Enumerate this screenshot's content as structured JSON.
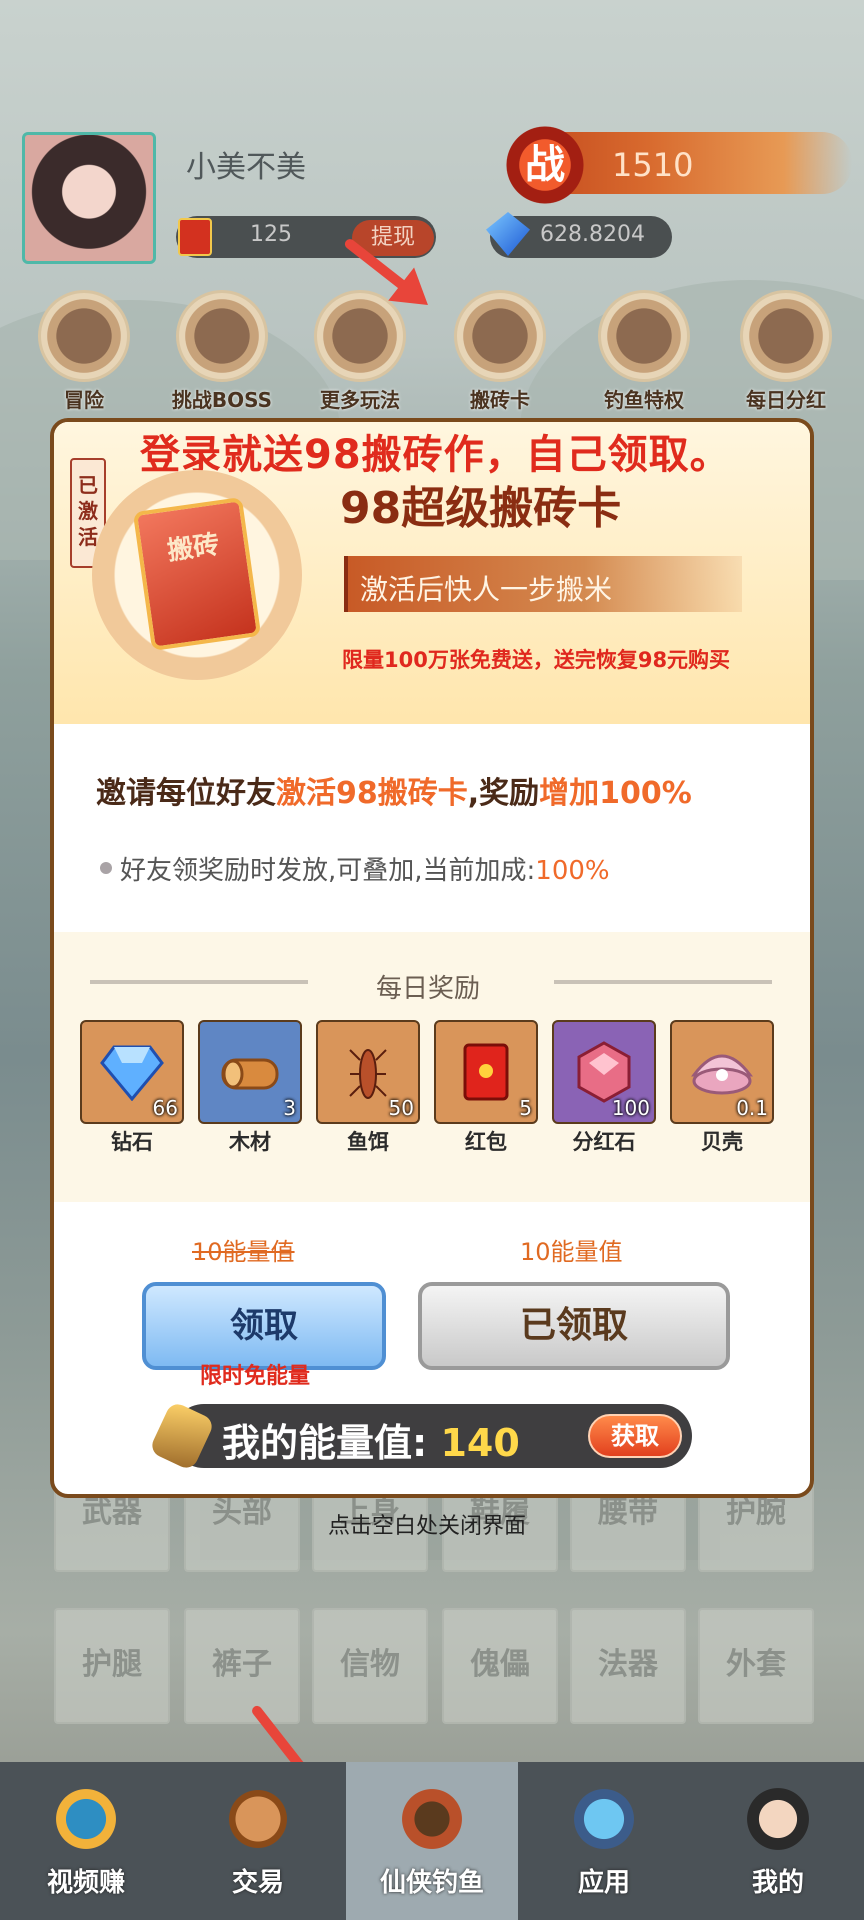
{
  "header": {
    "username": "小美不美",
    "power_glyph": "战",
    "power_value": "1510",
    "cash_value": "125",
    "withdraw_label": "提现",
    "gems_value": "628.8204"
  },
  "features": [
    {
      "label": "冒险"
    },
    {
      "label": "挑战BOSS"
    },
    {
      "label": "更多玩法"
    },
    {
      "label": "搬砖卡"
    },
    {
      "label": "钓鱼特权"
    },
    {
      "label": "每日分红"
    }
  ],
  "modal": {
    "headline": "登录就送98搬砖作，自己领取。",
    "activated_tag": "已激活",
    "card_glyph": "搬砖",
    "card_title": "98超级搬砖卡",
    "card_desc": "激活后快人一步搬米",
    "limit_text": "限量100万张免费送，送完恢复98元购买",
    "invite": {
      "p1": "邀请每位好友",
      "p2": "激活98搬砖卡",
      "p3": ",奖励",
      "p4": "增加100%"
    },
    "friend_note": {
      "text": "好友领奖励时发放,可叠加,当前加成:",
      "value": "100%"
    },
    "daily_title": "每日奖励",
    "rewards": [
      {
        "name": "钻石",
        "qty": "66",
        "icon": "diamond-icon",
        "bg": "#d9955a"
      },
      {
        "name": "木材",
        "qty": "3",
        "icon": "wood-icon",
        "bg": "#5f86c4"
      },
      {
        "name": "鱼饵",
        "qty": "50",
        "icon": "bait-icon",
        "bg": "#d9955a"
      },
      {
        "name": "红包",
        "qty": "5",
        "icon": "red-envelope-icon",
        "bg": "#d9955a"
      },
      {
        "name": "分红石",
        "qty": "100",
        "icon": "dividend-stone-icon",
        "bg": "#8a63b5"
      },
      {
        "name": "贝壳",
        "qty": "0.1",
        "icon": "shell-icon",
        "bg": "#d9955a"
      }
    ],
    "cost_original": "10能量值",
    "cost_current": "10能量值",
    "claim_label": "领取",
    "free_note": "限时免能量",
    "claimed_label": "已领取",
    "energy_label": "我的能量值: ",
    "energy_value": "140",
    "get_label": "获取"
  },
  "close_hint": "点击空白处关闭界面",
  "equipment_slots": [
    "武器",
    "头部",
    "上身",
    "鞋履",
    "腰带",
    "护腕",
    "护腿",
    "裤子",
    "信物",
    "傀儡",
    "法器",
    "外套"
  ],
  "bottom_nav": [
    {
      "label": "视频赚"
    },
    {
      "label": "交易"
    },
    {
      "label": "仙侠钓鱼"
    },
    {
      "label": "应用"
    },
    {
      "label": "我的"
    }
  ]
}
